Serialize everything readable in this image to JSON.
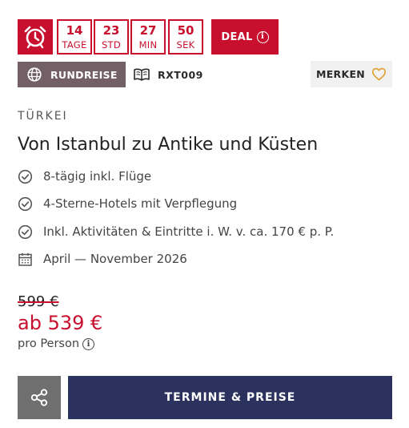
{
  "countdown": {
    "units": [
      {
        "value": "14",
        "label": "TAGE"
      },
      {
        "value": "23",
        "label": "STD"
      },
      {
        "value": "27",
        "label": "MIN"
      },
      {
        "value": "50",
        "label": "SEK"
      }
    ],
    "icon": "alarm-clock-icon"
  },
  "deal": {
    "label": "DEAL",
    "icon": "info-icon"
  },
  "tags": {
    "tour_type": {
      "label": "RUNDREISE",
      "icon": "globe-icon"
    },
    "code": {
      "label": "RXT009",
      "icon": "book-icon"
    }
  },
  "merken": {
    "label": "MERKEN",
    "icon": "heart-icon"
  },
  "country": "TÜRKEI",
  "title": "Von Istanbul zu Antike und Küsten",
  "features": [
    {
      "text": "8-tägig inkl. Flüge",
      "icon": "check-circle-icon"
    },
    {
      "text": "4-Sterne-Hotels mit Verpflegung",
      "icon": "check-circle-icon"
    },
    {
      "text": "Inkl. Aktivitäten & Eintritte i. W. v. ca. 170 € p. P.",
      "icon": "check-circle-icon"
    },
    {
      "text": "April — November 2026",
      "icon": "calendar-icon"
    }
  ],
  "price": {
    "old": "599 €",
    "new": "ab 539 €",
    "per": "pro Person"
  },
  "actions": {
    "share_icon": "share-icon",
    "cta_label": "TERMINE & PREISE"
  },
  "colors": {
    "accent_red": "#c8102e",
    "tag_mauve": "#736066",
    "cta_navy": "#2b325d",
    "share_gray": "#6f6f6f"
  }
}
